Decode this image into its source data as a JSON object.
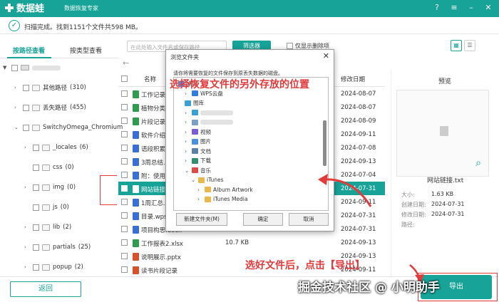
{
  "app": {
    "name": "数据蛙",
    "subtitle": "数据恢复专家"
  },
  "window_controls": [
    "?",
    "≡",
    "–",
    "✕"
  ],
  "scan": {
    "status": "扫描完成。找到1151个文件共598 MB。"
  },
  "left_tabs": [
    "按路径查看",
    "按类型查看"
  ],
  "tree": [
    {
      "label": "",
      "count": "",
      "level": 0,
      "open": true,
      "drive": true
    },
    {
      "label": "其他路径",
      "count": "(310)",
      "level": 1
    },
    {
      "label": "丢失路径",
      "count": "(455)",
      "level": 1
    },
    {
      "label": "SwitchyOmega_Chromium",
      "count": "",
      "level": 1,
      "open": true
    },
    {
      "label": "_locales",
      "count": "(6)",
      "level": 2
    },
    {
      "label": "css",
      "count": "(0)",
      "level": 2
    },
    {
      "label": "img",
      "count": "(0)",
      "level": 2
    },
    {
      "label": "js",
      "count": "(0)",
      "level": 2
    },
    {
      "label": "lib",
      "count": "(2)",
      "level": 2
    },
    {
      "label": "partials",
      "count": "(25)",
      "level": 2
    },
    {
      "label": "popup",
      "count": "(2)",
      "level": 2
    }
  ],
  "search": {
    "placeholder": "在此处输入文件名或保存路径"
  },
  "filter_button": "筛选器",
  "delete_only": "仅显示删除项",
  "columns": {
    "name": "名称",
    "size": "大小",
    "date": "修改日期"
  },
  "files": [
    {
      "name": "工作记录表",
      "size": "",
      "date": "2024-08-07",
      "color": "#2e9c4e"
    },
    {
      "name": "植物分类.c",
      "size": "",
      "date": "2024-08-07",
      "color": "#2e9c4e"
    },
    {
      "name": "片段记录.c",
      "size": "",
      "date": "2024-08-09",
      "color": "#2e9c4e"
    },
    {
      "name": "软件介绍 -",
      "size": "",
      "date": "2024-09-11",
      "color": "#3b6fd8"
    },
    {
      "name": "语段积累.c",
      "size": "",
      "date": "2024-07-08",
      "color": "#3b6fd8"
    },
    {
      "name": "3周总结.do",
      "size": "",
      "date": "2024-09-13",
      "color": "#3b6fd8"
    },
    {
      "name": "附：使用注",
      "size": "",
      "date": "2024-07-04",
      "color": "#3b6fd8"
    },
    {
      "name": "网站链接.t",
      "size": "",
      "date": "2024-07-31",
      "color": "#ffffff",
      "selected": true
    },
    {
      "name": "1周汇总.do",
      "size": "",
      "date": "2024-09-11",
      "color": "#3b6fd8"
    },
    {
      "name": "目录.wps",
      "size": "",
      "date": "2024-07-31",
      "color": "#3b6fd8"
    },
    {
      "name": "项目构思.docx",
      "size": "11.1 KB",
      "date": "2024-07-31",
      "color": "#3b6fd8"
    },
    {
      "name": "工作报表2.xlsx",
      "size": "10.7 KB",
      "date": "2024-09-13",
      "color": "#2e9c4e"
    },
    {
      "name": "说明展示.pptx",
      "size": "",
      "date": "2024-09-13",
      "color": "#d9512c"
    },
    {
      "name": "读书片段记录",
      "size": "",
      "date": "2024-09-11",
      "color": "#d9512c"
    }
  ],
  "preview": {
    "title": "预览",
    "file_name": "网站链接.txt",
    "rows": [
      {
        "label": "大小:",
        "value": "1.63 KB"
      },
      {
        "label": "创建日期:",
        "value": "2024-07-31"
      },
      {
        "label": "修改日期:",
        "value": "2024-07-31"
      },
      {
        "label": "路径:",
        "value": ""
      }
    ]
  },
  "back_button": "返回",
  "export_button": "导出",
  "dialog": {
    "title": "浏览文件夹",
    "close": "✕",
    "description": "请你将需要恢复的文件保存到原丢失数据的磁盘。",
    "items": [
      {
        "label": "桌面",
        "level": 0,
        "color": "#4a8fe0"
      },
      {
        "label": "WPS云盘",
        "level": 1,
        "color": "#2f7de1",
        "arrow": "›"
      },
      {
        "label": "图库",
        "level": 1,
        "color": "#3aa0d8",
        "arrow": ""
      },
      {
        "label": "",
        "level": 1,
        "color": "#3aa0d8",
        "arrow": "›",
        "blur": true
      },
      {
        "label": "",
        "level": 1,
        "color": "#7aa0c8",
        "arrow": "›",
        "blur": true
      },
      {
        "label": "视频",
        "level": 1,
        "color": "#7b5bd6",
        "arrow": "›"
      },
      {
        "label": "图片",
        "level": 1,
        "color": "#4a8fe0",
        "arrow": "›"
      },
      {
        "label": "文档",
        "level": 1,
        "color": "#5a7fa8",
        "arrow": "›"
      },
      {
        "label": "下载",
        "level": 1,
        "color": "#2f8f6e",
        "arrow": "›"
      },
      {
        "label": "音乐",
        "level": 1,
        "color": "#e24a4a",
        "arrow": "⌄"
      },
      {
        "label": "iTunes",
        "level": 2,
        "color": "#e8b94a",
        "arrow": "⌄"
      },
      {
        "label": "Album Artwork",
        "level": 3,
        "color": "#e8b94a",
        "arrow": "›"
      },
      {
        "label": "iTunes Media",
        "level": 3,
        "color": "#e8b94a",
        "arrow": "›"
      }
    ],
    "new_folder": "新建文件夹(M)",
    "ok": "确定",
    "cancel": "取消"
  },
  "annotations": {
    "top": "选择恢复文件的另外存放的位置",
    "bottom": "选好文件后，点击【导出】"
  },
  "watermark": "掘金技术社区 @ 小明助手"
}
